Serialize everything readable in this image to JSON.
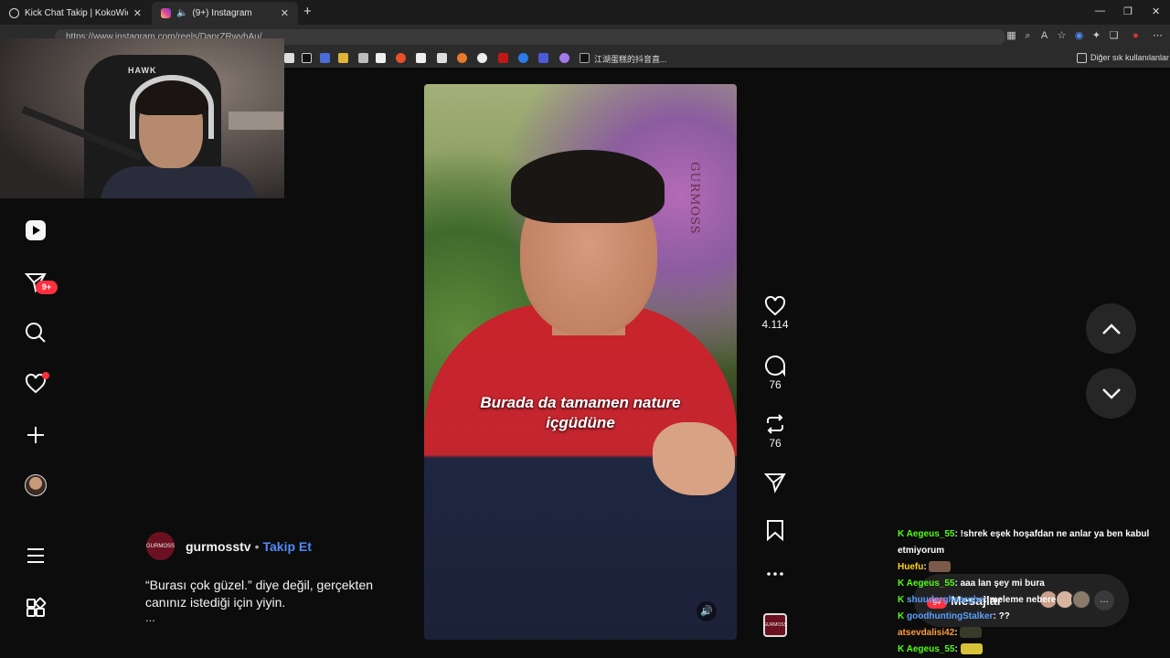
{
  "browser": {
    "tabs": [
      {
        "title": "Kick Chat Takip | KokoWich",
        "close": "✕"
      },
      {
        "title": "(9+) Instagram",
        "close": "✕"
      }
    ],
    "new_tab": "+",
    "window_controls": [
      "—",
      "❐",
      "✕"
    ],
    "url": "https://www.instagram.com/reels/DanrZRwvhAu/",
    "bookmark_label": "江湖蛋糕的抖音直...",
    "bookmarks_folder": "Diğer sık kullanılanlar"
  },
  "stream_overlay": {
    "webcam_logo": "HAWK"
  },
  "sidenav": {
    "items": [
      "reels",
      "messages",
      "search",
      "notifications",
      "create",
      "profile",
      "more",
      "apps"
    ],
    "messages_badge": "9+"
  },
  "reel": {
    "subtitle_line1": "Burada da tamamen nature",
    "subtitle_line2": "içgüdüne",
    "watermark": "GURMOSS",
    "owner": "gurmosstv",
    "separator": "•",
    "follow": "Takip Et",
    "avatar_text": "GURMOSS",
    "caption_line1": "“Burası çok güzel.” diye değil, gerçekten",
    "caption_line2": "canınız istediği için yiyin.",
    "more": "...",
    "likes": "4.114",
    "comments": "76",
    "reposts": "76"
  },
  "messages_pill": {
    "label": "Mesajlar",
    "badge": "9+",
    "more": "..."
  },
  "chat": [
    {
      "kick": true,
      "user": "Aegeus_55",
      "color": "#53fc18",
      "text": "!shrek eşek hoşafdan ne anlar ya ben kabul"
    },
    {
      "kick": false,
      "user": "",
      "color": "#ffffff",
      "text": "etmiyorum"
    },
    {
      "kick": false,
      "user": "Huefu",
      "color": "#ffd21f",
      "text": "",
      "emote": "#7a5a4a"
    },
    {
      "kick": true,
      "user": "Aegeus_55",
      "color": "#53fc18",
      "text": "aaa lan şey mi bura"
    },
    {
      "kick": true,
      "user": "shuuderghearghe",
      "color": "#5aa0ff",
      "text": "meleme nebere"
    },
    {
      "kick": true,
      "user": "goodhuntingStalker",
      "color": "#5aa0ff",
      "text": "??"
    },
    {
      "kick": false,
      "user": "atsevdalisi42",
      "color": "#ff9a3c",
      "text": "",
      "emote": "#3a3a2a"
    },
    {
      "kick": true,
      "user": "Aegeus_55",
      "color": "#53fc18",
      "text": "",
      "emote": "#d8c23a"
    }
  ]
}
